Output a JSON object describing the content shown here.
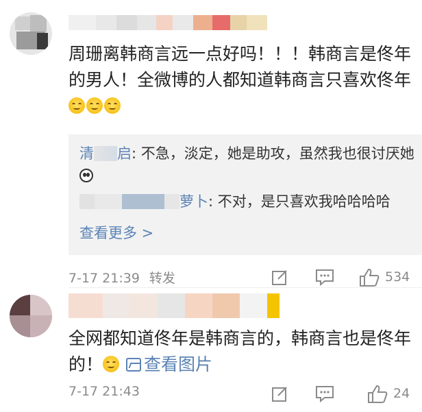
{
  "comments": [
    {
      "text": "周珊离韩商言远一点好吗！！！韩商言是佟年的男人！全微博的人都知道韩商言只喜欢佟年",
      "emoji_icon": "smile-emoji-icon",
      "replies": [
        {
          "name_visible_start": "清",
          "name_visible_end": "启",
          "text": ": 不急，淡定，她是助攻，虽然我也很讨厌她",
          "emoji_icon": "panda-face-emoji-icon"
        },
        {
          "name_visible_start": "",
          "name_visible_end": "萝卜",
          "text": ": 不对，是只喜欢我哈哈哈哈"
        }
      ],
      "more_label": "查看更多 >",
      "date": "7-17 21:39",
      "repost_label": "转发",
      "like_count": "534"
    },
    {
      "text": "全网都知道佟年是韩商言的，韩商言也是佟年的！",
      "emoji_icon": "smile-emoji-icon",
      "link_label": "查看图片",
      "date": "7-17 21:43",
      "like_count": "24"
    }
  ],
  "colors": {
    "link": "#5b83b5",
    "reply_bg": "#f2f2f2",
    "meta": "#8a8a8a",
    "text": "#222222"
  }
}
